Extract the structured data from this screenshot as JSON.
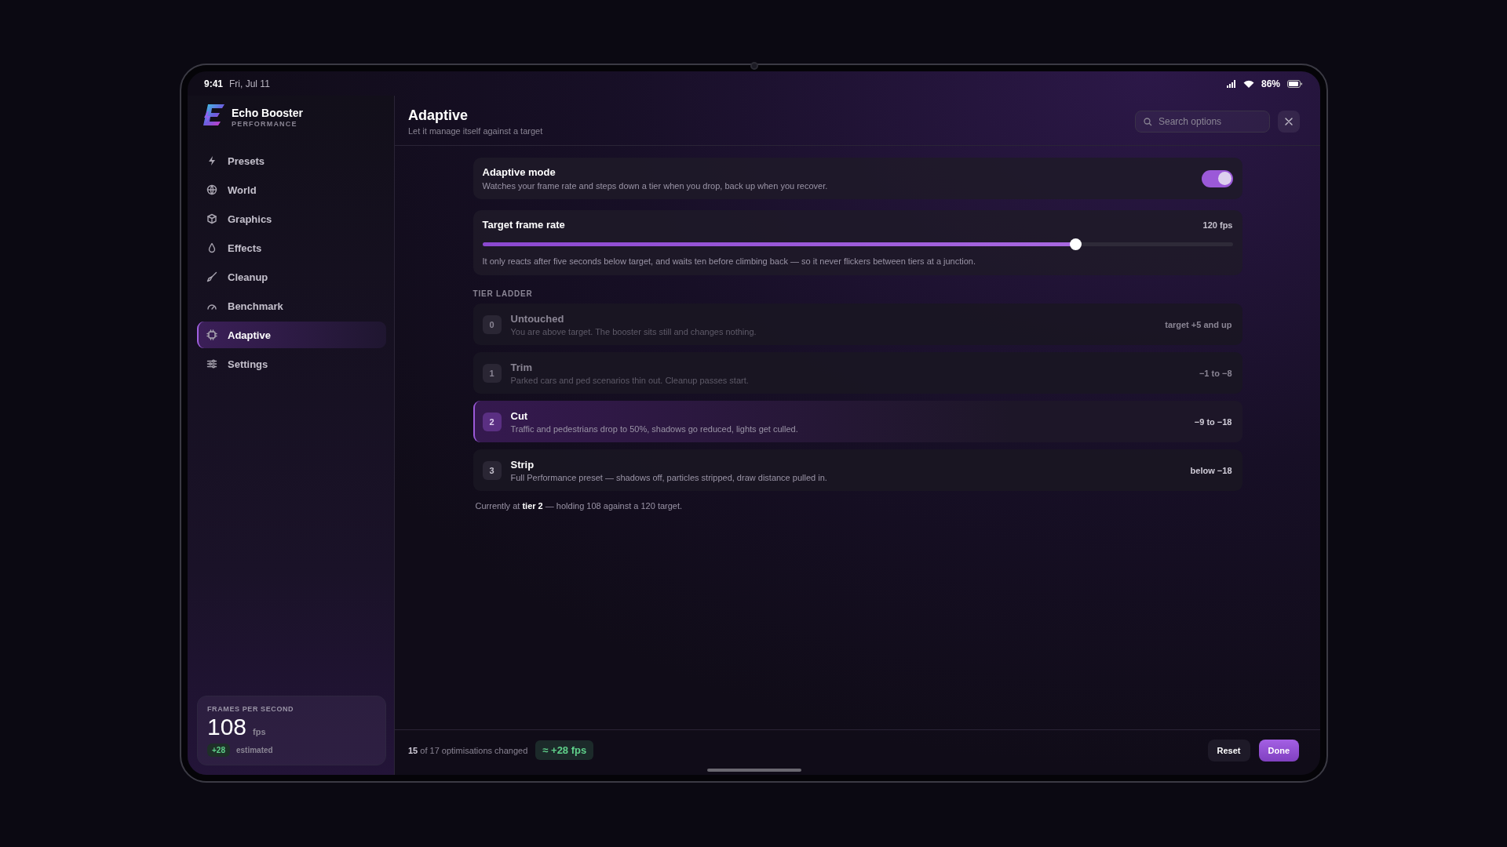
{
  "status_bar": {
    "time": "9:41",
    "date": "Fri, Jul 11",
    "battery": "86%"
  },
  "app": {
    "name": "Echo Booster",
    "subtitle": "PERFORMANCE"
  },
  "sidebar": {
    "items": [
      {
        "label": "Presets",
        "selected": false
      },
      {
        "label": "World",
        "selected": false
      },
      {
        "label": "Graphics",
        "selected": false
      },
      {
        "label": "Effects",
        "selected": false
      },
      {
        "label": "Cleanup",
        "selected": false
      },
      {
        "label": "Benchmark",
        "selected": false
      },
      {
        "label": "Adaptive",
        "selected": true
      },
      {
        "label": "Settings",
        "selected": false
      }
    ]
  },
  "fps_card": {
    "label": "FRAMES PER SECOND",
    "value": "108",
    "unit": "fps",
    "delta": "+28",
    "note": "estimated"
  },
  "header": {
    "title": "Adaptive",
    "subtitle": "Let it manage itself against a target",
    "search": {
      "placeholder": "Search options"
    }
  },
  "adaptive_mode": {
    "title": "Adaptive mode",
    "description": "Watches your frame rate and steps down a tier when you drop, back up when you recover.",
    "on": true
  },
  "target": {
    "title": "Target frame rate",
    "reading": "120 fps",
    "level": 0.79,
    "note": "It only reacts after five seconds below target, and waits ten before climbing back — so it never flickers between tiers at a junction."
  },
  "tier_ladder": {
    "heading": "TIER LADDER",
    "tiers": [
      {
        "number": "0",
        "name": "Untouched",
        "description": "You are above target. The booster sits still and changes nothing.",
        "range": "target +5 and up",
        "selected": false,
        "dimmed": true
      },
      {
        "number": "1",
        "name": "Trim",
        "description": "Parked cars and ped scenarios thin out. Cleanup passes start.",
        "range": "−1 to −8",
        "selected": false,
        "dimmed": true
      },
      {
        "number": "2",
        "name": "Cut",
        "description": "Traffic and pedestrians drop to 50%, shadows go reduced, lights get culled.",
        "range": "−9 to −18",
        "selected": true,
        "dimmed": false
      },
      {
        "number": "3",
        "name": "Strip",
        "description": "Full Performance preset — shadows off, particles stripped, draw distance pulled in.",
        "range": "below −18",
        "selected": false,
        "dimmed": false
      }
    ],
    "status": "Currently at **tier 2** — holding 108 against a 120 target."
  },
  "footer": {
    "summary": "**15** of 17 optimisations changed",
    "gain": "≈ +28 fps",
    "buttons": [
      "Reset",
      "Done"
    ]
  }
}
